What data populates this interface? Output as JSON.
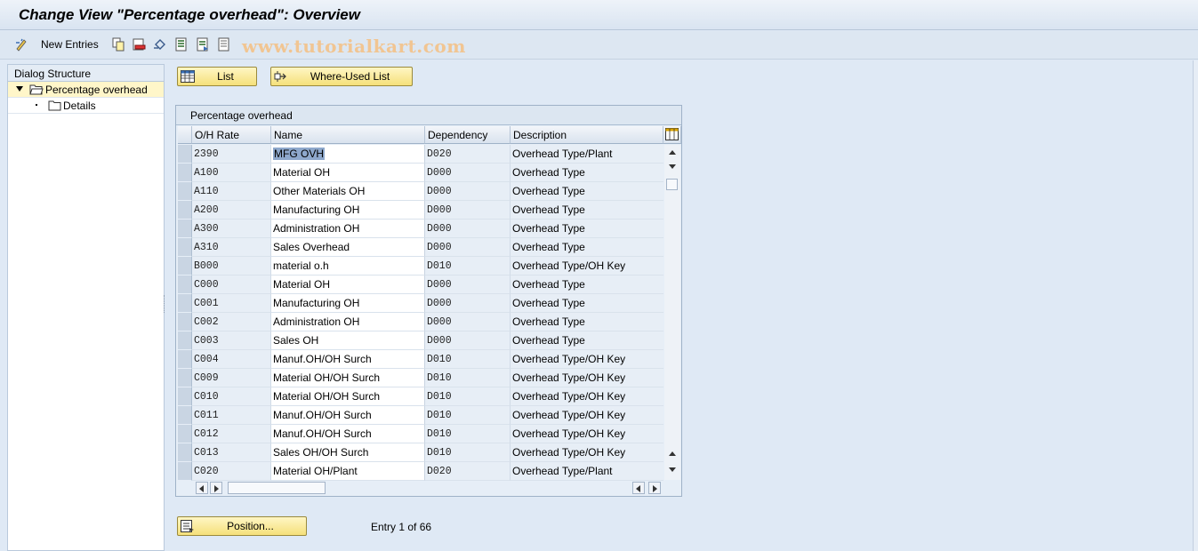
{
  "window": {
    "title": "Change View \"Percentage overhead\": Overview"
  },
  "toolbar": {
    "new_entries_label": "New Entries",
    "watermark": "www.tutorialkart.com"
  },
  "dialog_structure": {
    "title": "Dialog Structure",
    "items": [
      {
        "label": "Percentage overhead",
        "icon": "open-folder-icon",
        "selected": true
      },
      {
        "label": "Details",
        "icon": "folder-icon",
        "selected": false
      }
    ]
  },
  "buttons": {
    "list_label": "List",
    "where_used_label": "Where-Used List",
    "position_label": "Position..."
  },
  "table": {
    "title": "Percentage overhead",
    "columns": [
      "O/H Rate",
      "Name",
      "Dependency",
      "Description"
    ],
    "rows": [
      {
        "rate": "2390",
        "name": "MFG OVH",
        "dep": "D020",
        "desc": "Overhead Type/Plant"
      },
      {
        "rate": "A100",
        "name": "Material OH",
        "dep": "D000",
        "desc": "Overhead Type"
      },
      {
        "rate": "A110",
        "name": "Other Materials OH",
        "dep": "D000",
        "desc": "Overhead Type"
      },
      {
        "rate": "A200",
        "name": "Manufacturing OH",
        "dep": "D000",
        "desc": "Overhead Type"
      },
      {
        "rate": "A300",
        "name": "Administration OH",
        "dep": "D000",
        "desc": "Overhead Type"
      },
      {
        "rate": "A310",
        "name": "Sales Overhead",
        "dep": "D000",
        "desc": "Overhead Type"
      },
      {
        "rate": "B000",
        "name": "material o.h",
        "dep": "D010",
        "desc": "Overhead Type/OH Key"
      },
      {
        "rate": "C000",
        "name": "Material OH",
        "dep": "D000",
        "desc": "Overhead Type"
      },
      {
        "rate": "C001",
        "name": "Manufacturing OH",
        "dep": "D000",
        "desc": "Overhead Type"
      },
      {
        "rate": "C002",
        "name": "Administration OH",
        "dep": "D000",
        "desc": "Overhead Type"
      },
      {
        "rate": "C003",
        "name": "Sales OH",
        "dep": "D000",
        "desc": "Overhead Type"
      },
      {
        "rate": "C004",
        "name": "Manuf.OH/OH Surch",
        "dep": "D010",
        "desc": "Overhead Type/OH Key"
      },
      {
        "rate": "C009",
        "name": "Material OH/OH Surch",
        "dep": "D010",
        "desc": "Overhead Type/OH Key"
      },
      {
        "rate": "C010",
        "name": "Material OH/OH Surch",
        "dep": "D010",
        "desc": "Overhead Type/OH Key"
      },
      {
        "rate": "C011",
        "name": "Manuf.OH/OH Surch",
        "dep": "D010",
        "desc": "Overhead Type/OH Key"
      },
      {
        "rate": "C012",
        "name": "Manuf.OH/OH Surch",
        "dep": "D010",
        "desc": "Overhead Type/OH Key"
      },
      {
        "rate": "C013",
        "name": "Sales OH/OH Surch",
        "dep": "D010",
        "desc": "Overhead Type/OH Key"
      },
      {
        "rate": "C020",
        "name": "Material OH/Plant",
        "dep": "D020",
        "desc": "Overhead Type/Plant"
      }
    ]
  },
  "status": {
    "entry_text": "Entry 1 of 66"
  },
  "colors": {
    "accent_button": "#f5e07a",
    "selection": "#8ea8cc",
    "background": "#dfe9f5"
  }
}
